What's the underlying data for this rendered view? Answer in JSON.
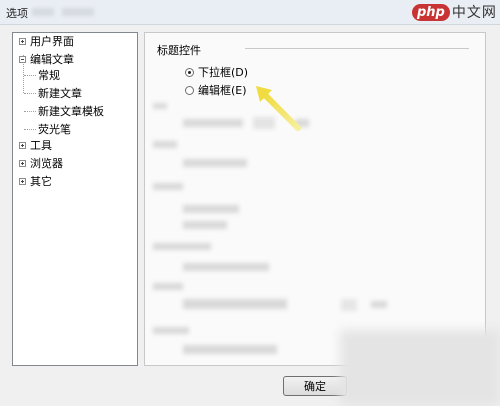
{
  "window": {
    "title": "选项"
  },
  "watermark": {
    "brand": "php",
    "text": "中文网"
  },
  "tree": {
    "items": [
      {
        "label": "用户界面",
        "expander": "plus"
      },
      {
        "label": "编辑文章",
        "expander": "minus"
      },
      {
        "label": "常规"
      },
      {
        "label": "新建文章"
      },
      {
        "label": "新建文章模板"
      },
      {
        "label": "荧光笔"
      },
      {
        "label": "工具",
        "expander": "plus"
      },
      {
        "label": "浏览器",
        "expander": "plus"
      },
      {
        "label": "其它",
        "expander": "plus"
      }
    ]
  },
  "panel": {
    "section_title": "标题控件",
    "options": [
      {
        "label": "下拉框(D)",
        "checked": true
      },
      {
        "label": "编辑框(E)",
        "checked": false
      }
    ]
  },
  "buttons": {
    "ok": "确定"
  },
  "annotation": {
    "arrow_color": "#f2e15a"
  }
}
